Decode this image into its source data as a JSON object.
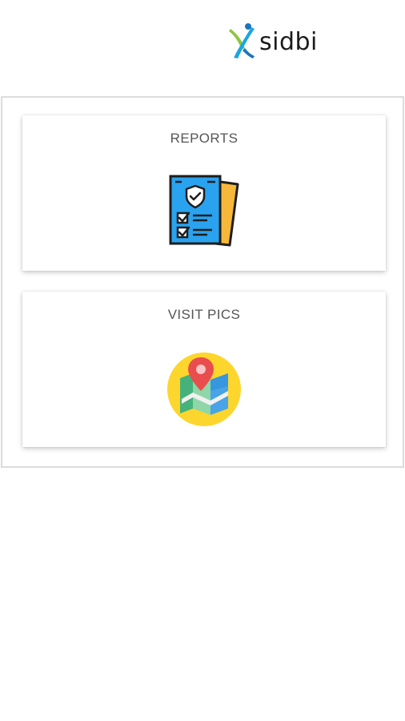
{
  "header": {
    "logo_text": "sidbi",
    "logo_icon": "sidbi-logo-mark"
  },
  "cards": [
    {
      "title": "REPORTS",
      "icon": "report-document-icon"
    },
    {
      "title": "VISIT PICS",
      "icon": "map-pin-icon"
    }
  ],
  "colors": {
    "background": "#ffffff",
    "panel_border": "#dcdcdc",
    "card_title": "#555555",
    "report_blue": "#29a3f0",
    "report_yellow": "#f6b83a",
    "map_circle": "#fcd62c",
    "pin_red": "#ea4d4d"
  }
}
